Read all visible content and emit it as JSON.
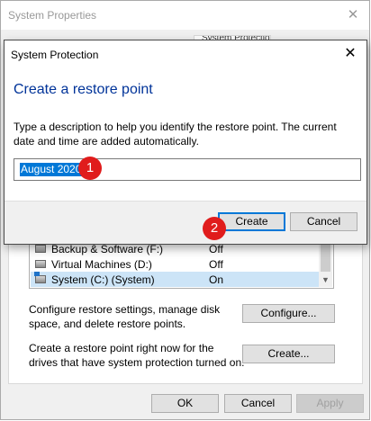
{
  "background_window": {
    "title": "System Properties",
    "active_tab_label": "System Protection",
    "drives": [
      {
        "name": "Backup & Software (F:)",
        "status": "Off",
        "icon": "drive-icon"
      },
      {
        "name": "Virtual Machines (D:)",
        "status": "Off",
        "icon": "drive-icon"
      },
      {
        "name": "System (C:) (System)",
        "status": "On",
        "icon": "system-drive-icon"
      }
    ],
    "configure_text": "Configure restore settings, manage disk space, and delete restore points.",
    "configure_button": "Configure...",
    "create_text": "Create a restore point right now for the drives that have system protection turned on.",
    "create_button": "Create...",
    "footer_buttons": {
      "ok": "OK",
      "cancel": "Cancel",
      "apply": "Apply"
    }
  },
  "dialog": {
    "title": "System Protection",
    "heading": "Create a restore point",
    "description": "Type a description to help you identify the restore point. The current date and time are added automatically.",
    "input_value": "August 2020",
    "create_button": "Create",
    "cancel_button": "Cancel"
  },
  "markers": [
    "1",
    "2"
  ],
  "colors": {
    "accent": "#0078d7",
    "heading": "#003399",
    "marker": "#e01c1c"
  }
}
